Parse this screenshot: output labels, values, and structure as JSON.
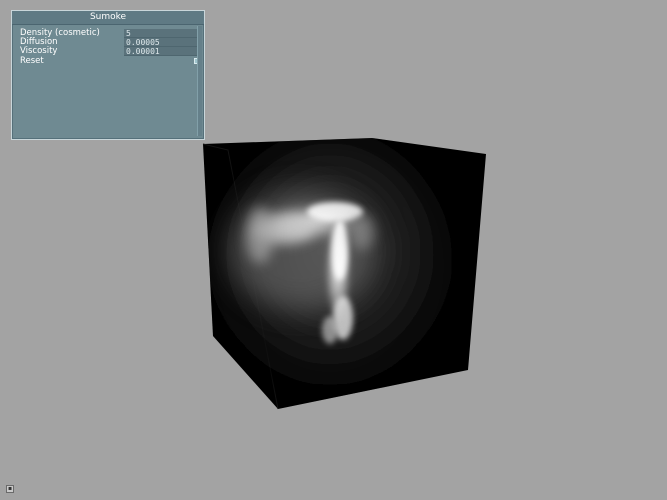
{
  "panel": {
    "title": "Sumoke",
    "rows": [
      {
        "label": "Density (cosmetic)",
        "value": "5"
      },
      {
        "label": "Diffusion",
        "value": "0.00005"
      },
      {
        "label": "Viscosity",
        "value": "0.00001"
      }
    ],
    "reset_label": "Reset"
  },
  "colors": {
    "background": "#a3a3a3",
    "panel": "#6f8a92",
    "panel_title_bar": "#5f7a84",
    "cube": "#000000",
    "smoke": "#ffffff"
  },
  "icons": {
    "corner": "minimize-icon"
  }
}
